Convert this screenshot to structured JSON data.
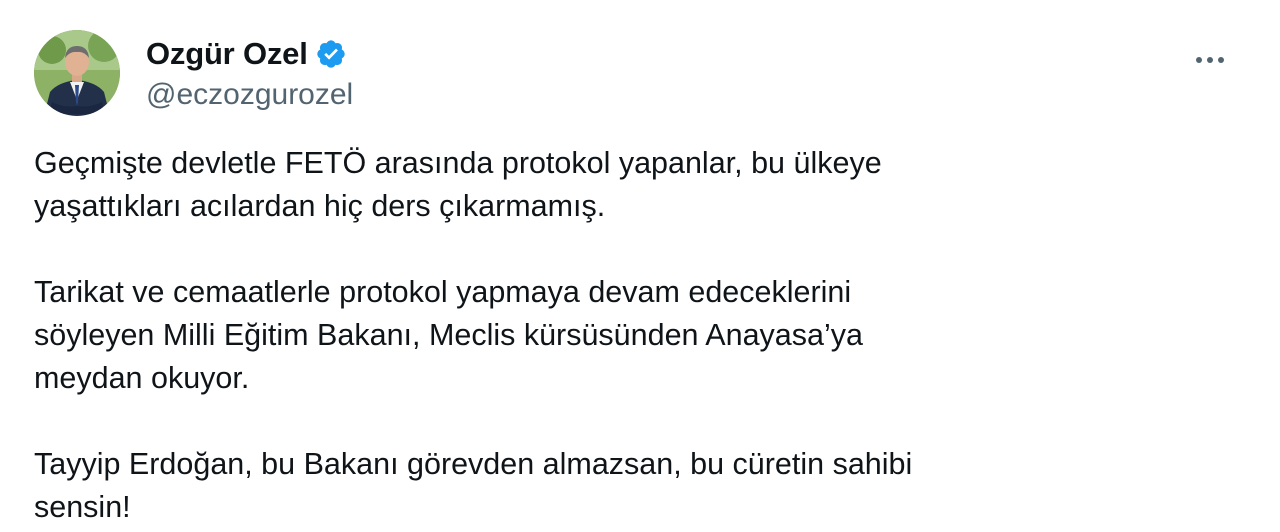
{
  "tweet": {
    "author": {
      "display_name": "Ozgür Ozel",
      "handle": "@eczozgurozel",
      "avatar_icon": "profile-photo",
      "verified_icon": "verified-badge-icon",
      "verified_color": "#1d9bf0"
    },
    "more_icon": "more-options-icon",
    "paragraphs": [
      "Geçmişte devletle FETÖ arasında protokol yapanlar, bu ülkeye\nyaşattıkları acılardan hiç ders çıkarmamış.",
      "Tarikat ve cemaatlerle protokol yapmaya devam edeceklerini\nsöyleyen Milli Eğitim Bakanı, Meclis kürsüsünden Anayasa’ya\nmeydan okuyor.",
      "Tayyip Erdoğan, bu Bakanı görevden almazsan, bu cüretin sahibi\nsensin!"
    ]
  }
}
